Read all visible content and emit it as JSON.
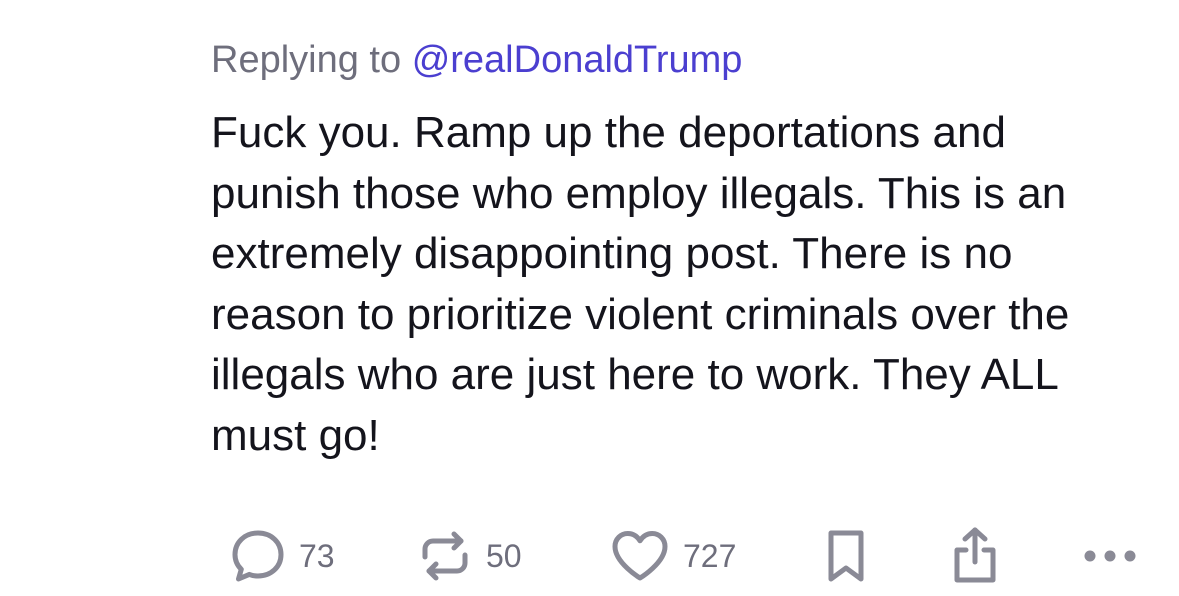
{
  "reply": {
    "prefix": "Replying to",
    "handle": "@realDonaldTrump"
  },
  "post": {
    "text": "Fuck you. Ramp up the deportations and punish those who employ illegals. This is an extremely disappointing post. There is no reason to prioritize violent criminals over the illegals who are just here to work. They ALL must go!"
  },
  "actions": {
    "reply_count": "73",
    "repost_count": "50",
    "like_count": "727",
    "icons": [
      "comment-icon",
      "repost-icon",
      "heart-icon",
      "bookmark-icon",
      "share-icon",
      "more-icon"
    ]
  },
  "colors": {
    "handle": "#4b3fd0",
    "muted": "#6e6e7c",
    "text": "#14141c",
    "icon": "#8a8a96"
  }
}
